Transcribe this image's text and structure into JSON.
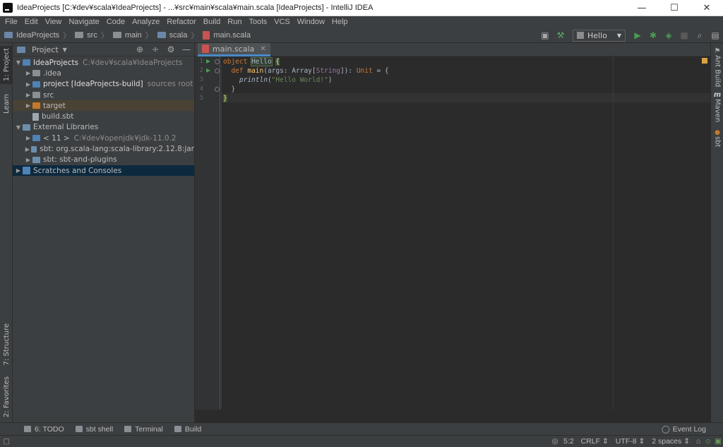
{
  "window": {
    "title": "IdeaProjects [C:¥dev¥scala¥IdeaProjects] - ...¥src¥main¥scala¥main.scala [IdeaProjects] - IntelliJ IDEA",
    "minimize": "—",
    "maximize": "☐",
    "close": "✕"
  },
  "menu": [
    "File",
    "Edit",
    "View",
    "Navigate",
    "Code",
    "Analyze",
    "Refactor",
    "Build",
    "Run",
    "Tools",
    "VCS",
    "Window",
    "Help"
  ],
  "breadcrumbs": [
    "IdeaProjects",
    "src",
    "main",
    "scala",
    "main.scala"
  ],
  "run_config": "Hello",
  "left_tools": {
    "project": "1: Project",
    "learn": "Learn",
    "structure": "7: Structure",
    "favorites": "2: Favorites"
  },
  "right_tools": {
    "ant": "Ant Build",
    "maven": "Maven",
    "sbt": "sbt",
    "maven_glyph": "m"
  },
  "project_panel": {
    "title": "Project",
    "tree": [
      {
        "name": "IdeaProjects",
        "extra": "C:¥dev¥scala¥IdeaProjects"
      },
      {
        "name": ".idea"
      },
      {
        "name": "project [IdeaProjects-build]",
        "extra": "sources root"
      },
      {
        "name": "src"
      },
      {
        "name": "target"
      },
      {
        "name": "build.sbt"
      },
      {
        "name": "External Libraries"
      },
      {
        "name": "< 11 >",
        "extra": "C:¥dev¥openjdk¥jdk-11.0.2"
      },
      {
        "name": "sbt: org.scala-lang:scala-library:2.12.8:jar"
      },
      {
        "name": "sbt: sbt-and-plugins"
      },
      {
        "name": "Scratches and Consoles"
      }
    ]
  },
  "editor": {
    "tab": "main.scala",
    "line_numbers": [
      "1",
      "2",
      "3",
      "4",
      "5"
    ],
    "code": {
      "l1_kw": "object",
      "l1_name": "Hello",
      "l1_brace": "{",
      "l2_kw": "def",
      "l2_fn": "main",
      "l2_args": "(args: Array[",
      "l2_tparam": "String",
      "l2_close": "]): ",
      "l2_unit": "Unit",
      "l2_eq": " = {",
      "l3_call": "println",
      "l3_open": "(",
      "l3_str": "\"Hello World!\"",
      "l3_close": ")",
      "l4": "}",
      "l5": "}"
    }
  },
  "bottom_tabs": [
    "6: TODO",
    "sbt shell",
    "Terminal",
    "Build"
  ],
  "event_log": "Event Log",
  "status": {
    "position": "5:2",
    "line_sep": "CRLF ⇕",
    "encoding": "UTF-8 ⇕",
    "indent": "2 spaces ⇕"
  }
}
